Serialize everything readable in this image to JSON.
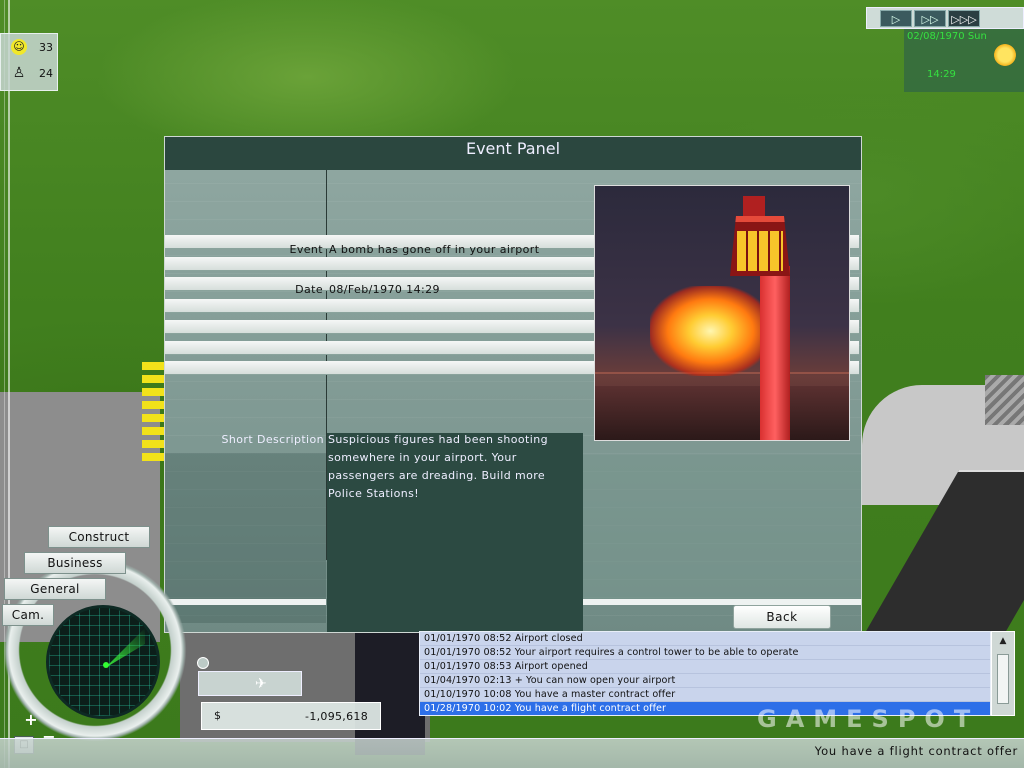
{
  "stats": {
    "happiness_value": "33",
    "staff_value": "24"
  },
  "speed_controls": {
    "buttons": [
      "play-normal",
      "play-fast",
      "play-fastest"
    ],
    "glyphs": [
      "▷",
      "▷▷",
      "▷▷▷"
    ]
  },
  "clock": {
    "date": "02/08/1970 Sun",
    "time": "14:29",
    "weather_icon": "sun-icon"
  },
  "event_panel": {
    "title": "Event Panel",
    "event_label": "Event",
    "event_value": "A bomb has gone off in your airport",
    "date_label": "Date",
    "date_value": "08/Feb/1970   14:29",
    "description_label": "Short Description",
    "description_text": "Suspicious figures had been shooting somewhere in your airport. Your passengers are dreading. Build more Police Stations!",
    "back_label": "Back"
  },
  "menu": {
    "construct": "Construct",
    "business": "Business",
    "general": "General",
    "camera": "Cam."
  },
  "money": {
    "symbol": "$",
    "value": "-1,095,618"
  },
  "message_log": {
    "entries": [
      "01/01/1970 08:52 Airport closed",
      "01/01/1970 08:52 Your airport requires a control tower to be able to operate",
      "01/01/1970 08:53 Airport opened",
      "01/04/1970 02:13 + You can now open your airport",
      "01/10/1970 10:08 You have a master contract offer",
      "01/28/1970 10:02 You have a flight contract offer"
    ],
    "selected_index": 5
  },
  "status_bar": {
    "text": "You have a flight contract offer"
  },
  "watermark": {
    "text": "GAMESPOT"
  },
  "colors": {
    "panel_bg": "#2d4a40",
    "clock_text": "#35e040",
    "log_selected": "#2d6fe8"
  }
}
